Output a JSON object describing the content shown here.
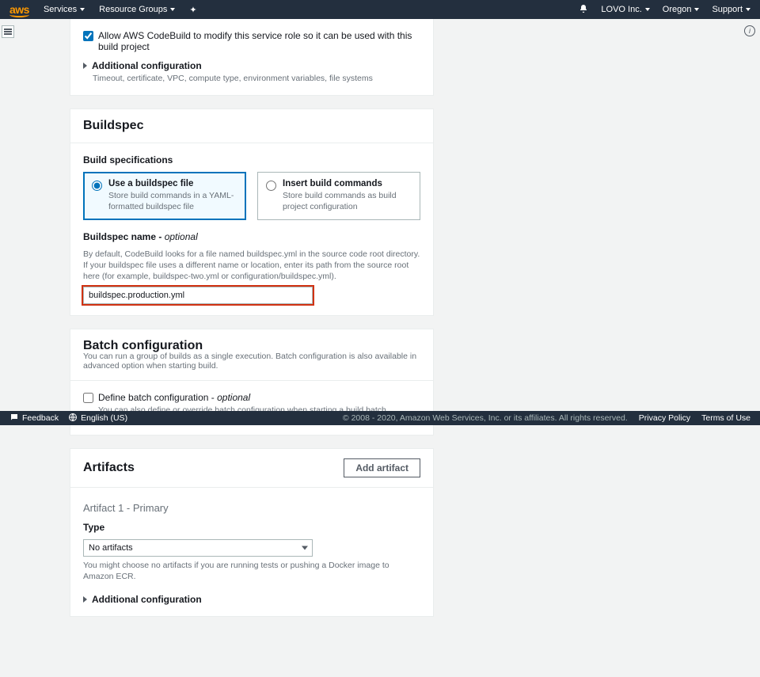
{
  "topnav": {
    "logo": "aws",
    "services": "Services",
    "resource_groups": "Resource Groups",
    "account": "LOVO Inc.",
    "region": "Oregon",
    "support": "Support"
  },
  "env_panel": {
    "allow_role_label": "Allow AWS CodeBuild to modify this service role so it can be used with this build project",
    "additional_cfg": "Additional configuration",
    "additional_cfg_desc": "Timeout, certificate, VPC, compute type, environment variables, file systems"
  },
  "buildspec": {
    "title": "Buildspec",
    "spec_label": "Build specifications",
    "option_file_title": "Use a buildspec file",
    "option_file_desc": "Store build commands in a YAML-formatted buildspec file",
    "option_cmd_title": "Insert build commands",
    "option_cmd_desc": "Store build commands as build project configuration",
    "name_label": "Buildspec name - ",
    "name_optional": "optional",
    "name_desc": "By default, CodeBuild looks for a file named buildspec.yml in the source code root directory. If your buildspec file uses a different name or location, enter its path from the source root here (for example, buildspec-two.yml or configuration/buildspec.yml).",
    "name_value": "buildspec.production.yml"
  },
  "batch": {
    "title": "Batch configuration",
    "desc": "You can run a group of builds as a single execution. Batch configuration is also available in advanced option when starting build.",
    "define_label": "Define batch configuration - ",
    "define_optional": "optional",
    "define_desc": "You can also define or override batch configuration when starting a build batch."
  },
  "artifacts": {
    "title": "Artifacts",
    "add_btn": "Add artifact",
    "primary_title": "Artifact 1 - Primary",
    "type_label": "Type",
    "type_value": "No artifacts",
    "type_desc": "You might choose no artifacts if you are running tests or pushing a Docker image to Amazon ECR.",
    "additional_cfg": "Additional configuration"
  },
  "footer": {
    "feedback": "Feedback",
    "language": "English (US)",
    "copyright": "© 2008 - 2020, Amazon Web Services, Inc. or its affiliates. All rights reserved.",
    "privacy": "Privacy Policy",
    "terms": "Terms of Use"
  }
}
